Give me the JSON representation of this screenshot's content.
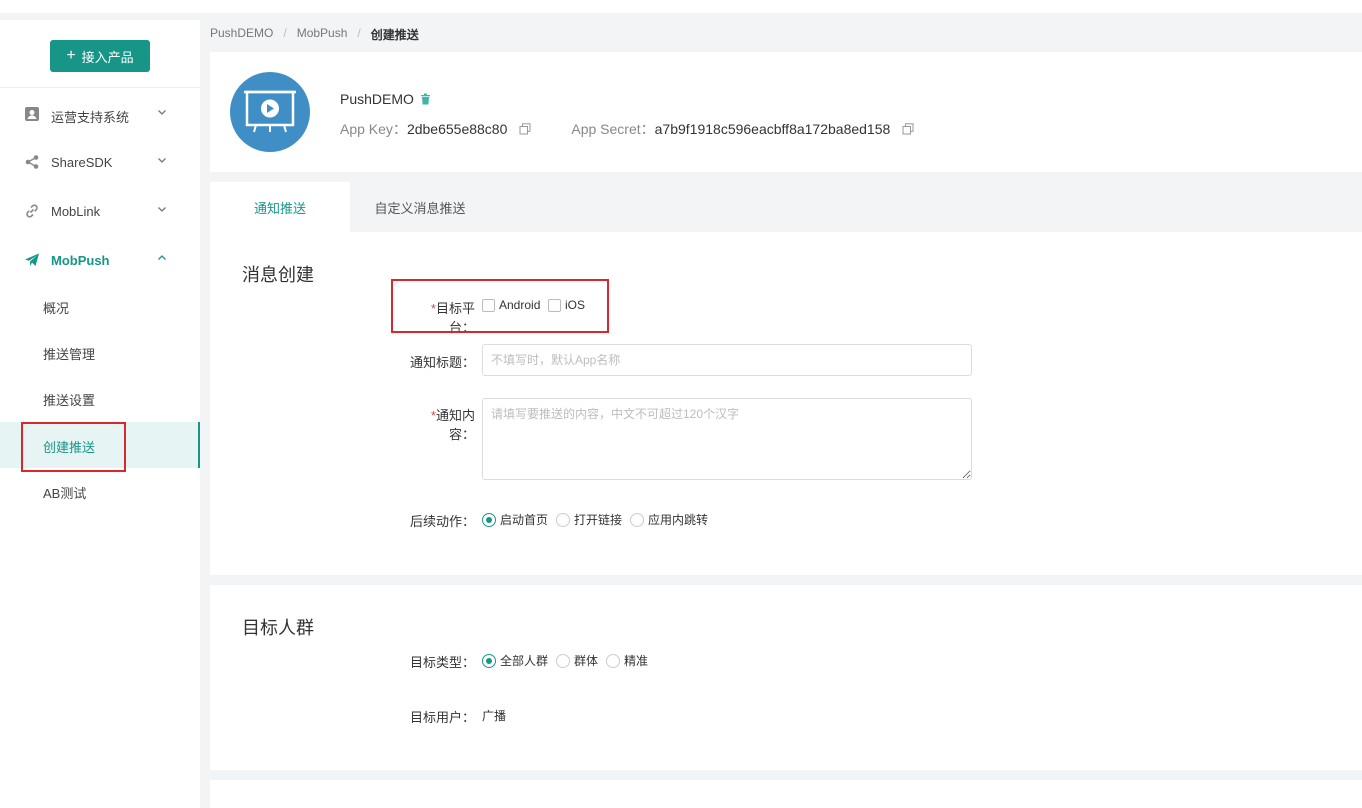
{
  "sidebar": {
    "add_button": "接入产品",
    "groups": [
      {
        "label": "运营支持系统",
        "icon": "user-card-icon",
        "expanded": false
      },
      {
        "label": "ShareSDK",
        "icon": "share-icon",
        "expanded": false
      },
      {
        "label": "MobLink",
        "icon": "link-icon",
        "expanded": false
      },
      {
        "label": "MobPush",
        "icon": "paper-plane-icon",
        "expanded": true
      }
    ],
    "subitems": [
      "概况",
      "推送管理",
      "推送设置",
      "创建推送",
      "AB测试"
    ],
    "current_subitem": "创建推送"
  },
  "breadcrumb": [
    "PushDEMO",
    "MobPush",
    "创建推送"
  ],
  "app": {
    "name": "PushDEMO",
    "key_label": "App Key：",
    "key_value": "2dbe655e88c80",
    "secret_label": "App Secret：",
    "secret_value": "a7b9f1918c596eacbff8a172ba8ed158"
  },
  "tabs": [
    "通知推送",
    "自定义消息推送"
  ],
  "message": {
    "title": "消息创建",
    "platform_label": "目标平台：",
    "platforms": [
      "Android",
      "iOS"
    ],
    "notify_title_label": "通知标题：",
    "notify_title_placeholder": "不填写时，默认App名称",
    "content_label": "通知内容：",
    "content_placeholder": "请填写要推送的内容，中文不可超过120个汉字",
    "action_label": "后续动作：",
    "actions": [
      "启动首页",
      "打开链接",
      "应用内跳转"
    ],
    "selected_action": "启动首页"
  },
  "audience": {
    "title": "目标人群",
    "type_label": "目标类型：",
    "types": [
      "全部人群",
      "群体",
      "精准"
    ],
    "selected_type": "全部人群",
    "user_label": "目标用户：",
    "user_value": "广播"
  },
  "colors": {
    "accent": "#179688",
    "highlight": "#d9272e",
    "avatar": "#3f8ec6"
  }
}
